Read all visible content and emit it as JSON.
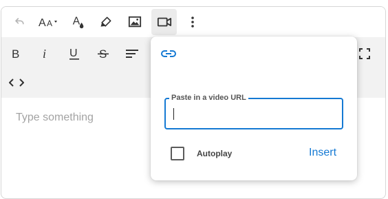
{
  "editor": {
    "placeholder": "Type something"
  },
  "toolbar": {
    "row1": [
      {
        "name": "undo-icon",
        "enabled": false
      },
      {
        "name": "font-size-dropdown-icon"
      },
      {
        "name": "text-color-icon"
      },
      {
        "name": "highlight-icon"
      },
      {
        "name": "image-icon"
      },
      {
        "name": "video-icon",
        "active": true
      },
      {
        "name": "more-vertical-icon"
      }
    ],
    "row2": [
      {
        "name": "bold-icon"
      },
      {
        "name": "italic-icon"
      },
      {
        "name": "underline-icon"
      },
      {
        "name": "strikethrough-icon"
      },
      {
        "name": "align-icon"
      },
      {
        "name": "fullscreen-icon"
      }
    ],
    "row3": [
      {
        "name": "code-view-icon"
      }
    ]
  },
  "video_popup": {
    "link_icon": "link-icon",
    "url_label": "Paste in a video URL",
    "url_value": "",
    "autoplay_label": "Autoplay",
    "autoplay_checked": false,
    "insert_label": "Insert"
  },
  "colors": {
    "accent": "#1479d3",
    "icon": "#333333",
    "icon_disabled": "#b5b5b5",
    "toolbar_gray": "#f2f2f2",
    "placeholder": "#a3a3a3"
  }
}
